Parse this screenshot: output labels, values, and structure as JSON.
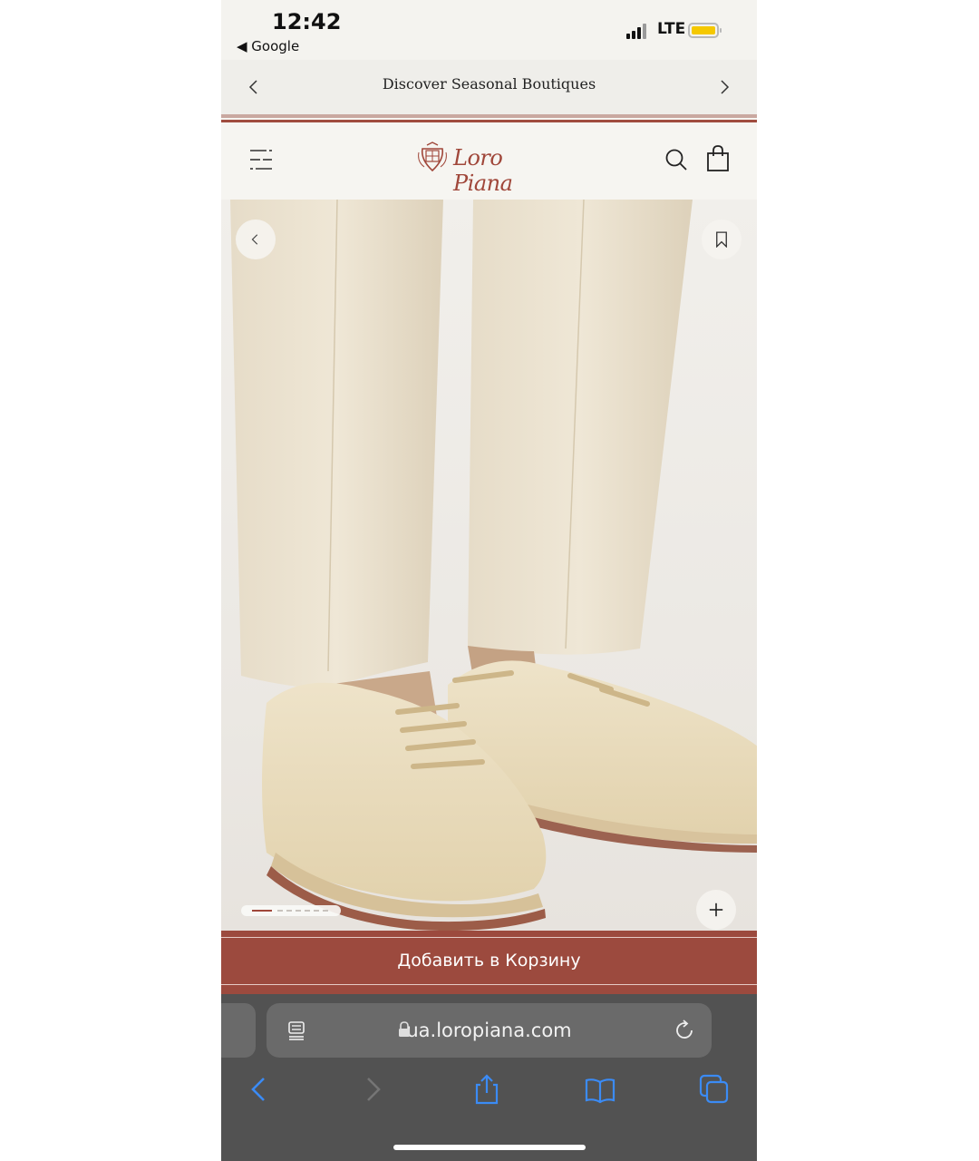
{
  "status_bar": {
    "time": "12:42",
    "back_app": "◀ Google",
    "network": "LTE",
    "battery_color": "#f5c800"
  },
  "announcement": {
    "message": "Discover Seasonal Boutiques",
    "prev_icon": "chevron-left-icon",
    "next_icon": "chevron-right-icon"
  },
  "header": {
    "brand": "Loro Piana",
    "menu_icon": "hamburger-icon",
    "search_icon": "search-icon",
    "bag_icon": "shopping-bag-icon",
    "brand_color": "#a0473a"
  },
  "gallery": {
    "back_icon": "chevron-left-icon",
    "bookmark_icon": "bookmark-icon",
    "zoom_icon": "plus-icon",
    "slide_count": 7,
    "current_slide": 1
  },
  "cart": {
    "label": "Добавить в Корзину",
    "color": "#9c4a3e"
  },
  "browser": {
    "url": "ua.loropiana.com",
    "icons": [
      "reader-icon",
      "lock-icon",
      "reload-icon",
      "back-icon",
      "forward-icon",
      "share-icon",
      "bookmarks-icon",
      "tabs-icon"
    ]
  }
}
